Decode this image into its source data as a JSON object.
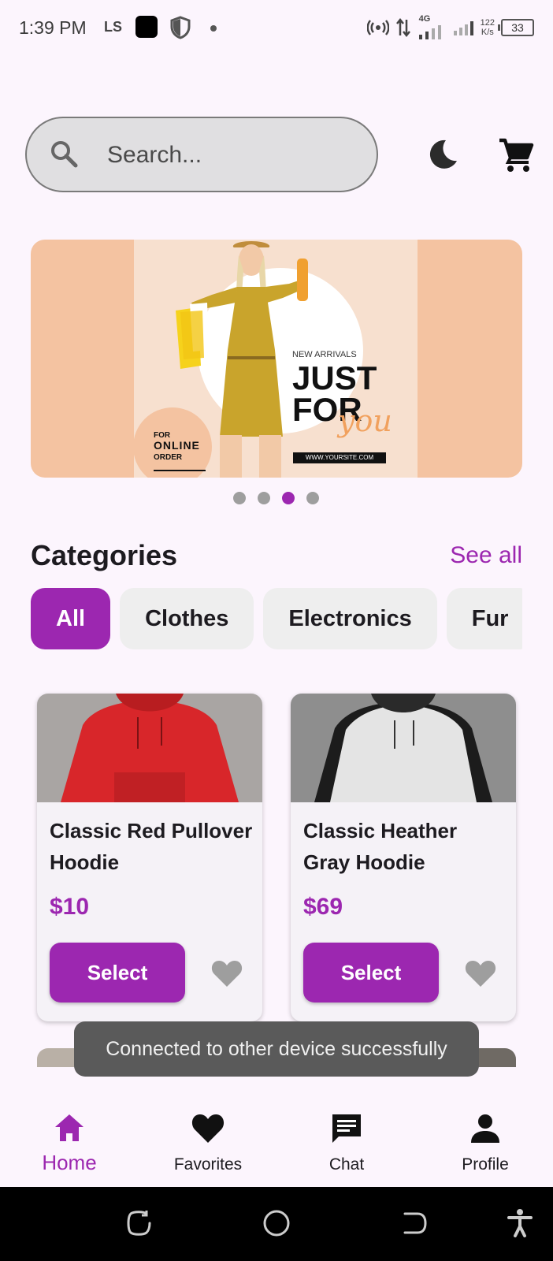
{
  "status_bar": {
    "time": "1:39 PM",
    "carrier_badge": "LS",
    "network": "4G",
    "speed_value": "122",
    "speed_unit": "K/s",
    "battery": "33"
  },
  "search": {
    "placeholder": "Search...",
    "value": ""
  },
  "header_icons": {
    "theme": "moon-icon",
    "cart": "shopping-cart-icon"
  },
  "banner": {
    "kicker": "NEW ARRIVALS",
    "headline_line1": "JUST",
    "headline_line2": "FOR",
    "headline_script": "you",
    "url": "WWW.YOURSITE.COM",
    "badge_top": "FOR",
    "badge_main": "ONLINE",
    "badge_bottom": "ORDER",
    "dots": {
      "count": 4,
      "active_index": 2
    }
  },
  "categories": {
    "title": "Categories",
    "see_all": "See all",
    "chips": [
      {
        "label": "All",
        "active": true
      },
      {
        "label": "Clothes",
        "active": false
      },
      {
        "label": "Electronics",
        "active": false
      },
      {
        "label": "Fur",
        "active": false
      }
    ]
  },
  "products": [
    {
      "name": "Classic Red Pullover Hoodie",
      "price": "$10",
      "action": "Select",
      "image_color": "#d8262a"
    },
    {
      "name": "Classic Heather Gray Hoodie",
      "price": "$69",
      "action": "Select",
      "image_color": "#e0e0e0"
    }
  ],
  "toast": {
    "message": "Connected to other device successfully"
  },
  "bottom_nav": {
    "items": [
      {
        "label": "Home",
        "icon": "home-icon",
        "active": true
      },
      {
        "label": "Favorites",
        "icon": "heart-icon",
        "active": false
      },
      {
        "label": "Chat",
        "icon": "chat-icon",
        "active": false
      },
      {
        "label": "Profile",
        "icon": "person-icon",
        "active": false
      }
    ]
  },
  "colors": {
    "accent": "#9c27b0",
    "background": "#fcf5fd",
    "chip_inactive": "#eeeeee",
    "favorite_inactive": "#9e9e9e"
  }
}
